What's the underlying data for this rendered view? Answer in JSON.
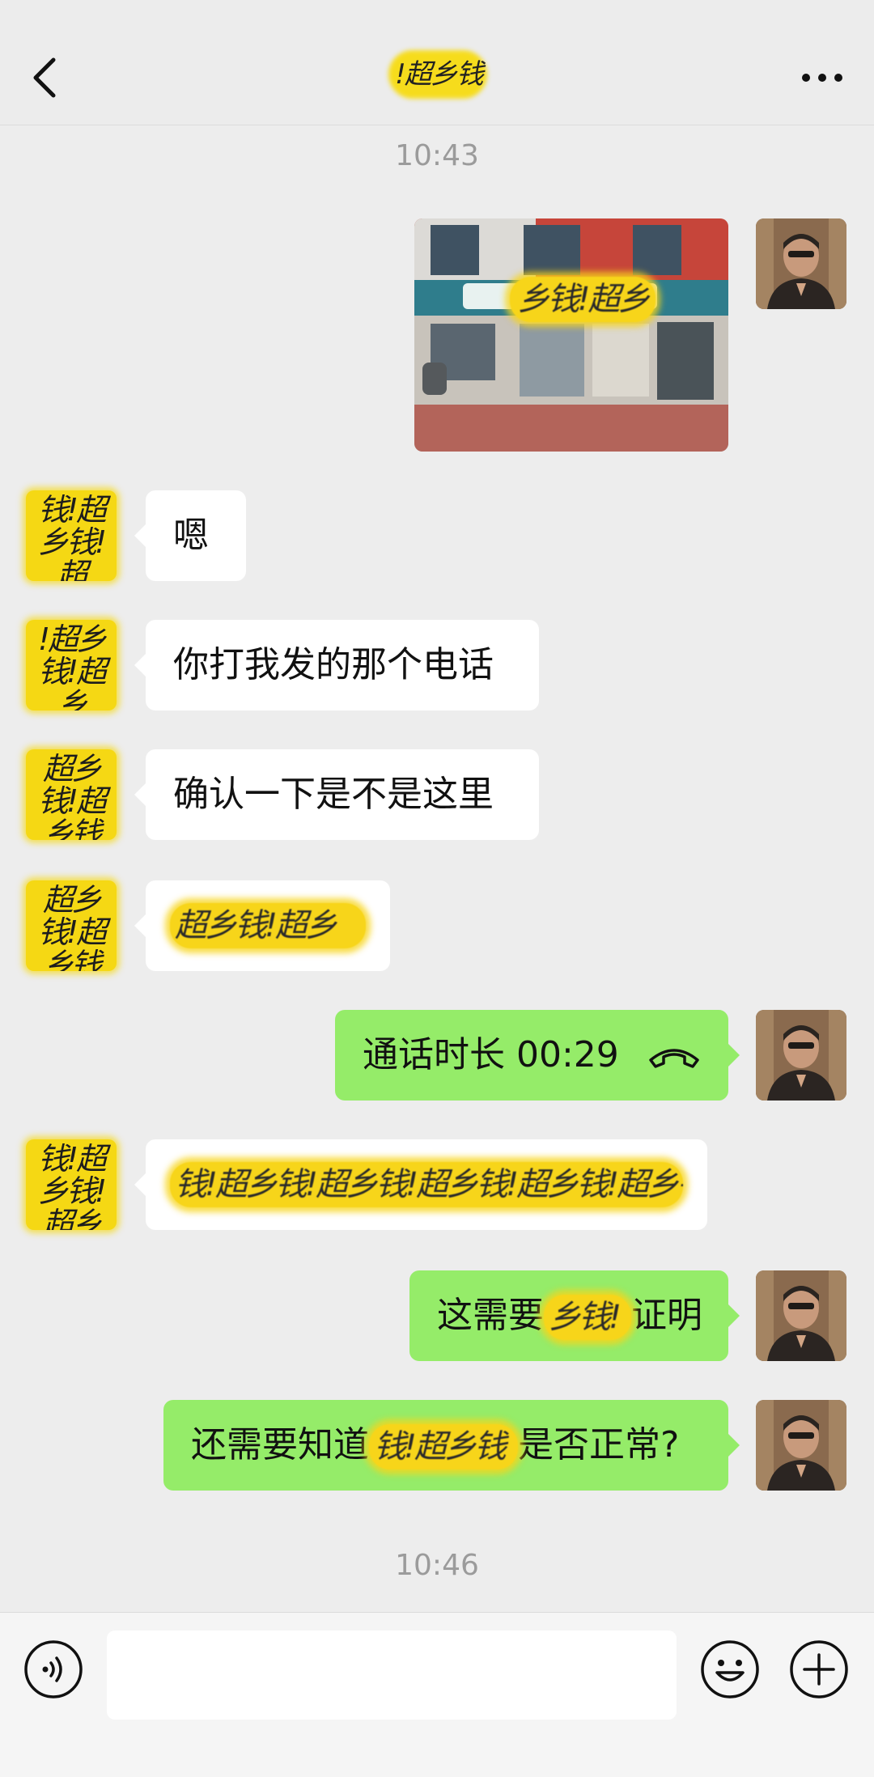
{
  "header": {
    "title": "!超乡钱",
    "back_icon": "chevron-left-icon",
    "more_icon": "more-icon"
  },
  "timestamps": [
    "10:43",
    "10:46"
  ],
  "messages": [
    {
      "side": "out",
      "type": "image",
      "sign_text": "乡钱!超乡"
    },
    {
      "side": "in",
      "type": "text",
      "text": "嗯",
      "avatar_text": "钱!超乡钱!超"
    },
    {
      "side": "in",
      "type": "text",
      "text": "你打我发的那个电话",
      "avatar_text": "!超乡钱!超乡"
    },
    {
      "side": "in",
      "type": "text",
      "text": "确认一下是不是这里",
      "avatar_text": "超乡钱!超乡钱"
    },
    {
      "side": "in",
      "type": "text",
      "text": "超乡钱!超乡",
      "avatar_text": "超乡钱!超乡钱"
    },
    {
      "side": "out",
      "type": "call",
      "text": "通话时长 00:29",
      "icon": "phone-hangup-icon"
    },
    {
      "side": "in",
      "type": "text",
      "text": "钱!超乡钱!超乡钱!超乡钱!超乡钱!超乡钱!超",
      "avatar_text": "钱!超乡钱!超乡"
    },
    {
      "side": "out",
      "type": "text",
      "prefix": "这需要",
      "masked": "乡钱!",
      "suffix": "证明"
    },
    {
      "side": "out",
      "type": "text",
      "prefix": "还需要知道",
      "masked": "钱!超乡钱",
      "suffix": "是否正常?"
    }
  ],
  "bottombar": {
    "input_value": "",
    "voice_icon": "voice-icon",
    "emoji_icon": "emoji-icon",
    "plus_icon": "plus-icon"
  },
  "colors": {
    "background": "#ededed",
    "bubble_out": "#95ec69",
    "bubble_in": "#ffffff",
    "mask_yellow": "#f7d51a"
  }
}
